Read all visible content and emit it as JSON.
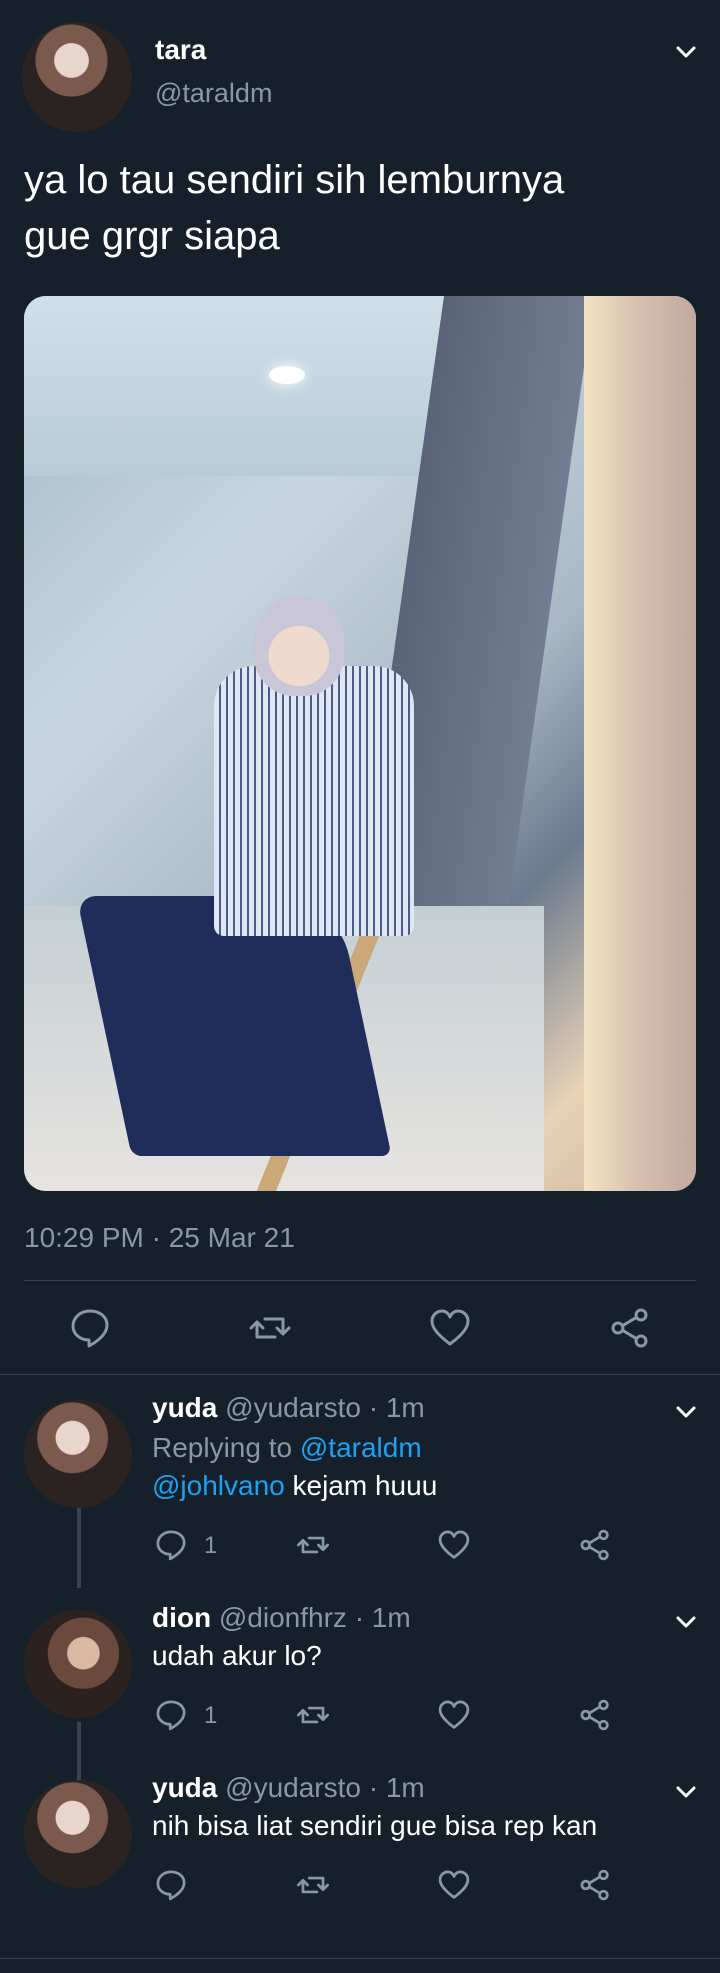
{
  "tweet": {
    "display_name": "tara",
    "handle": "@taraldm",
    "text_line1": "ya lo tau sendiri sih lemburnya",
    "text_line2": "gue grgr siapa",
    "timestamp": "10:29 PM · 25 Mar 21"
  },
  "replies": [
    {
      "display_name": "yuda",
      "handle_time": "@yudarsto · 1m",
      "replying_label": "Replying to ",
      "replying_to": "@taraldm",
      "mention": "@johlvano",
      "text": " kejam huuu",
      "reply_count": "1"
    },
    {
      "display_name": "dion",
      "handle_time": "@dionfhrz · 1m",
      "text": "udah akur lo?",
      "reply_count": "1"
    },
    {
      "display_name": "yuda",
      "handle_time": "@yudarsto · 1m",
      "text": "nih bisa liat sendiri gue bisa rep kan"
    }
  ],
  "icons": {
    "reply": "reply-icon",
    "retweet": "retweet-icon",
    "like": "heart-icon",
    "share": "share-icon",
    "menu": "chevron-down-icon"
  },
  "colors": {
    "background": "#15202b",
    "muted": "#8899a6",
    "link": "#1da1f2",
    "divider": "#38444d"
  }
}
